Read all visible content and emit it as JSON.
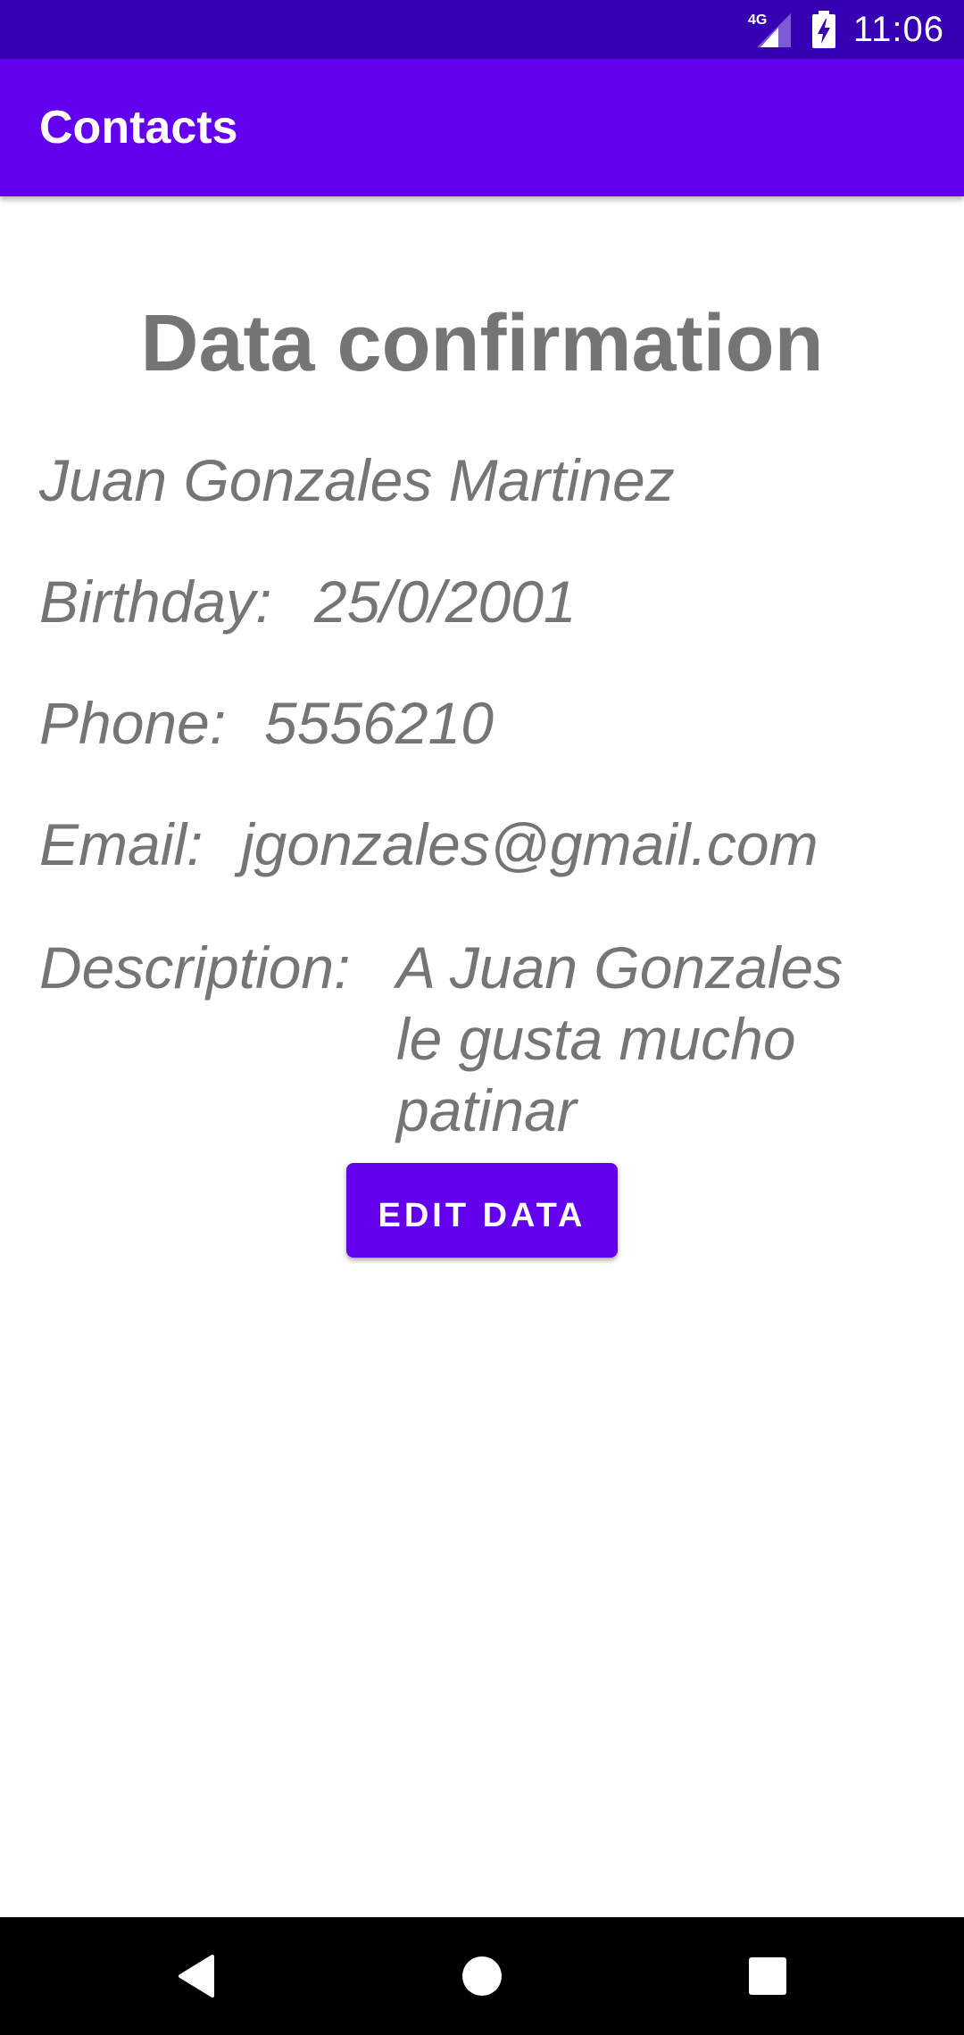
{
  "status_bar": {
    "network": "4G",
    "time": "11:06",
    "icons": [
      "signal-icon",
      "battery-charging-icon"
    ]
  },
  "app_bar": {
    "title": "Contacts"
  },
  "main": {
    "heading": "Data confirmation",
    "name": "Juan Gonzales Martinez",
    "birthday": {
      "label": "Birthday:",
      "value": "25/0/2001"
    },
    "phone": {
      "label": "Phone:",
      "value": "5556210"
    },
    "email": {
      "label": "Email:",
      "value": "jgonzales@gmail.com"
    },
    "description": {
      "label": "Description:",
      "value": "A Juan Gonzales le gusta mucho patinar"
    },
    "edit_button": "EDIT DATA"
  },
  "nav_bar": {
    "icons": [
      "back-icon",
      "home-icon",
      "recents-icon"
    ]
  },
  "colors": {
    "primary": "#6200ee",
    "primary_dark": "#3700b3",
    "text_gray": "#757575"
  }
}
